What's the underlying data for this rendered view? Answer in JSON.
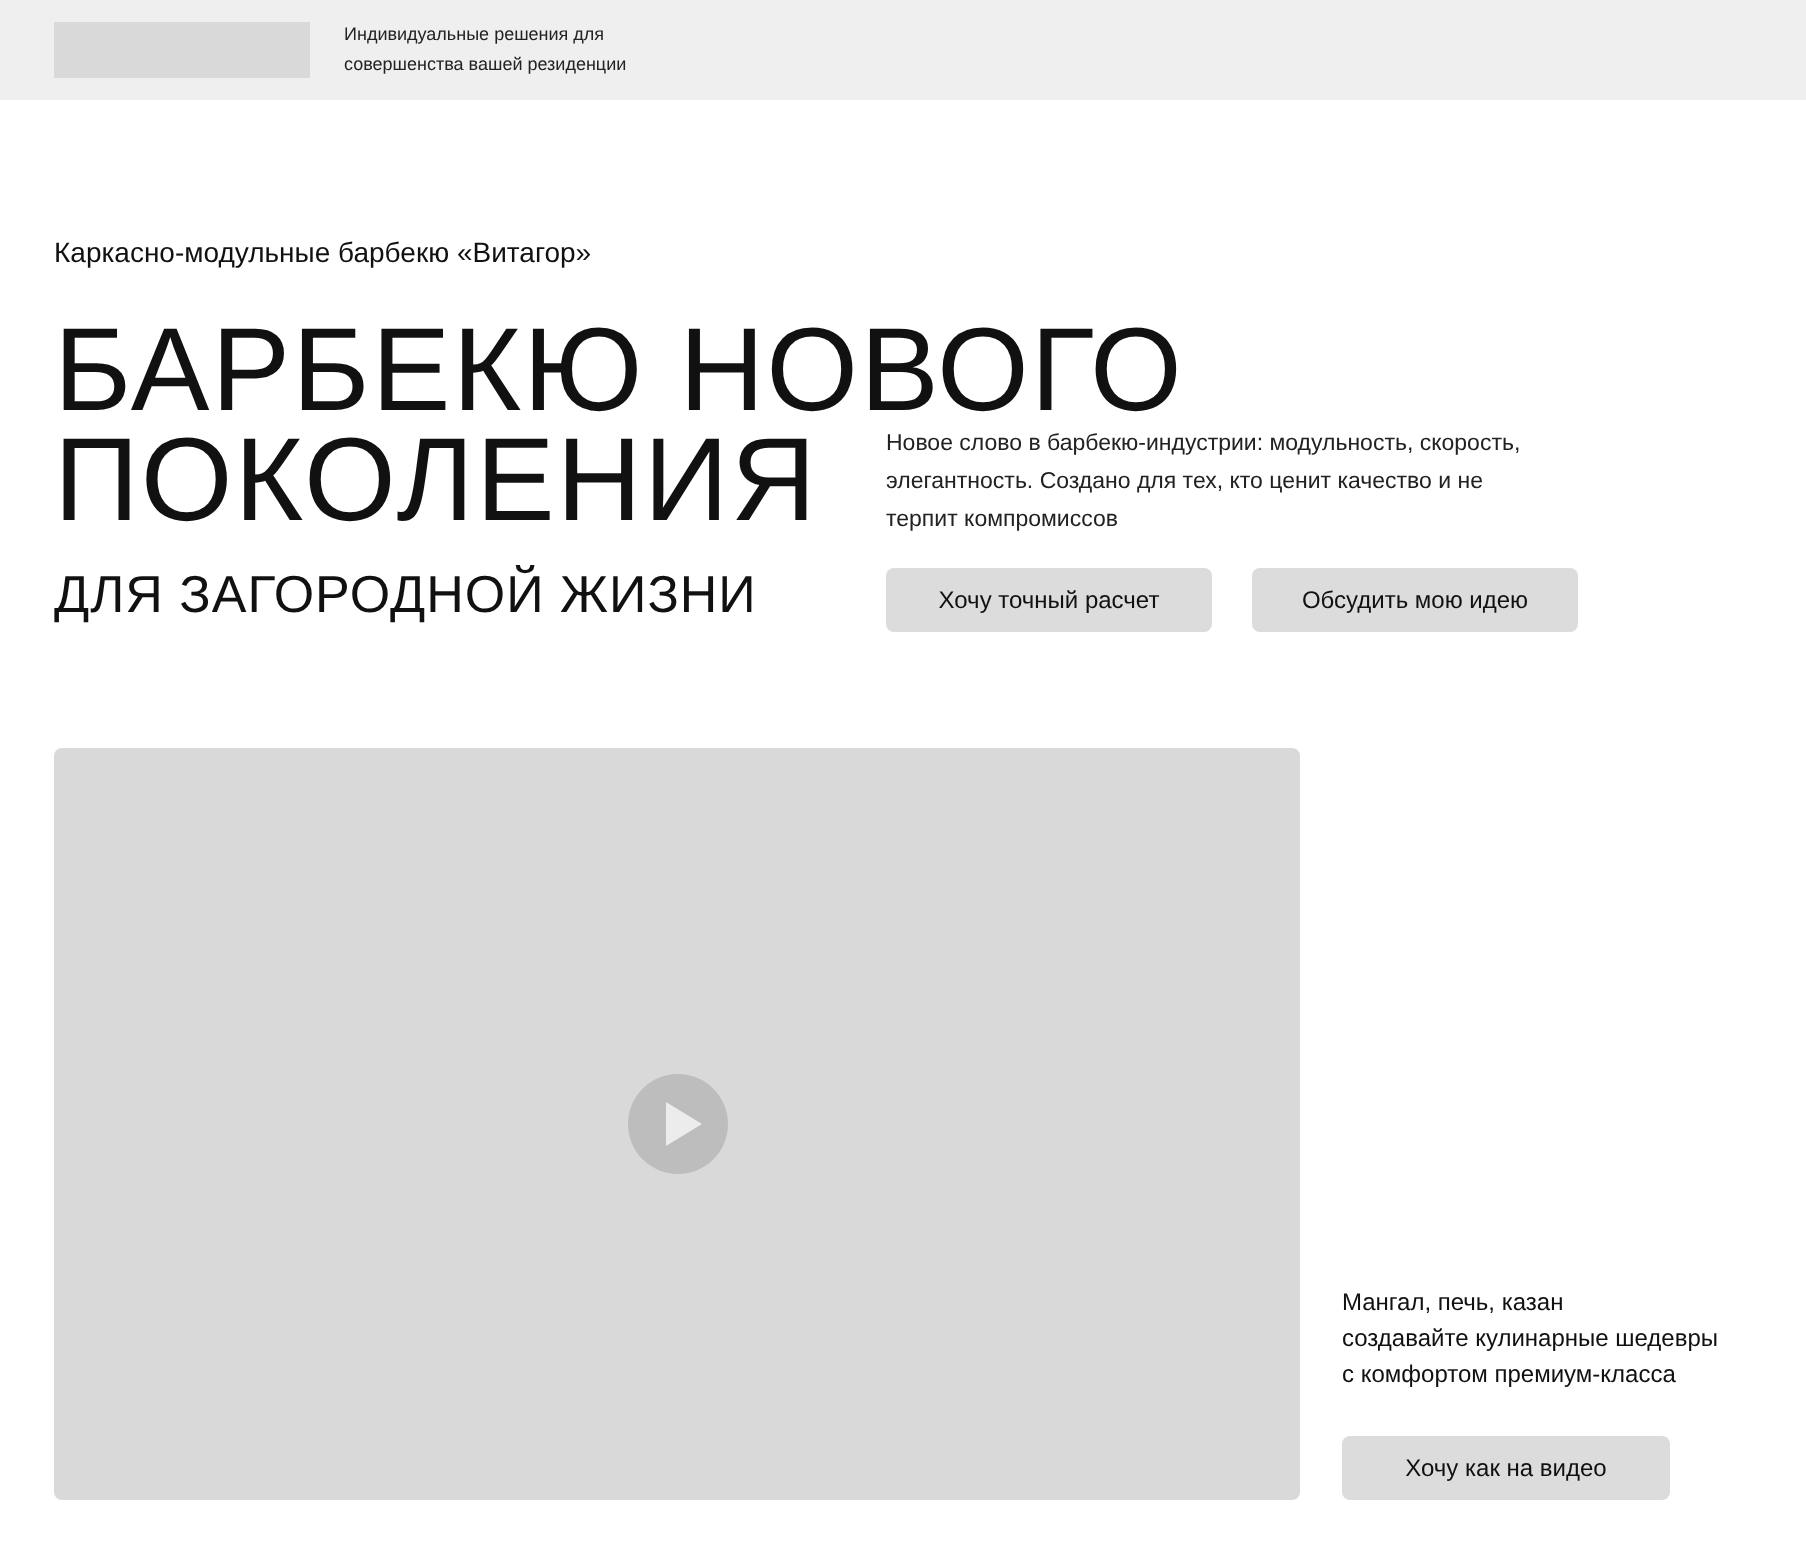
{
  "header": {
    "tagline": [
      "Индивидуальные решения для",
      "совершенства вашей резиденции"
    ]
  },
  "hero": {
    "eyebrow": "Каркасно-модульные барбекю «Витагор»",
    "title_lines": [
      "БАРБЕКЮ НОВОГО",
      "ПОКОЛЕНИЯ"
    ],
    "subtitle": "ДЛЯ ЗАГОРОДНОЙ ЖИЗНИ",
    "description": "Новое слово в барбекю-индустрии: модульность, скорость, элегантность. Создано для тех, кто ценит качество и не терпит компромиссов",
    "buttons": [
      "Хочу точный расчет",
      "Обсудить мою идею"
    ]
  },
  "video": {
    "caption": [
      "Мангал, печь, казан",
      "создавайте кулинарные шедевры",
      "с комфортом премиум-класса"
    ],
    "button": "Хочу как на видео"
  }
}
